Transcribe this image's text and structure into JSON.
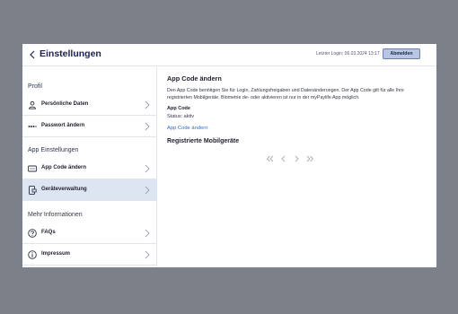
{
  "header": {
    "title": "Einstellungen",
    "login_info": "Letzter Login: 06.03.2024 13:17",
    "logout_label": "Abmelden"
  },
  "sidebar": {
    "sections": [
      {
        "title": "Profil"
      },
      {
        "title": "App Einstellungen"
      },
      {
        "title": "Mehr Informationen"
      }
    ],
    "items": [
      {
        "label": "Persönliche Daten",
        "icon": "person-icon"
      },
      {
        "label": "Passwort ändern",
        "icon": "password-icon"
      },
      {
        "label": "App Code ändern",
        "icon": "app-code-icon"
      },
      {
        "label": "Geräteverwaltung",
        "icon": "device-icon",
        "active": true
      },
      {
        "label": "FAQs",
        "icon": "question-icon"
      },
      {
        "label": "Impressum",
        "icon": "info-icon"
      }
    ]
  },
  "main": {
    "heading": "App Code ändern",
    "description": "Den App Code benötigen Sie für Login, Zahlungsfreigaben und Datenänderungen. Der App Code gilt für alle Ihre registrierten Mobilgeräte. Biometrie de- oder aktivieren ist nur in der myPaylife App möglich.",
    "code_label": "App Code",
    "status": "Status: aktiv",
    "link": "App Code ändern",
    "devices_heading": "Registrierte Mobilgeräte"
  },
  "colors": {
    "accent": "#1b2150",
    "link": "#2f6cc4",
    "active_bg": "#dde5f2",
    "button_bg": "#b8c6e2"
  }
}
